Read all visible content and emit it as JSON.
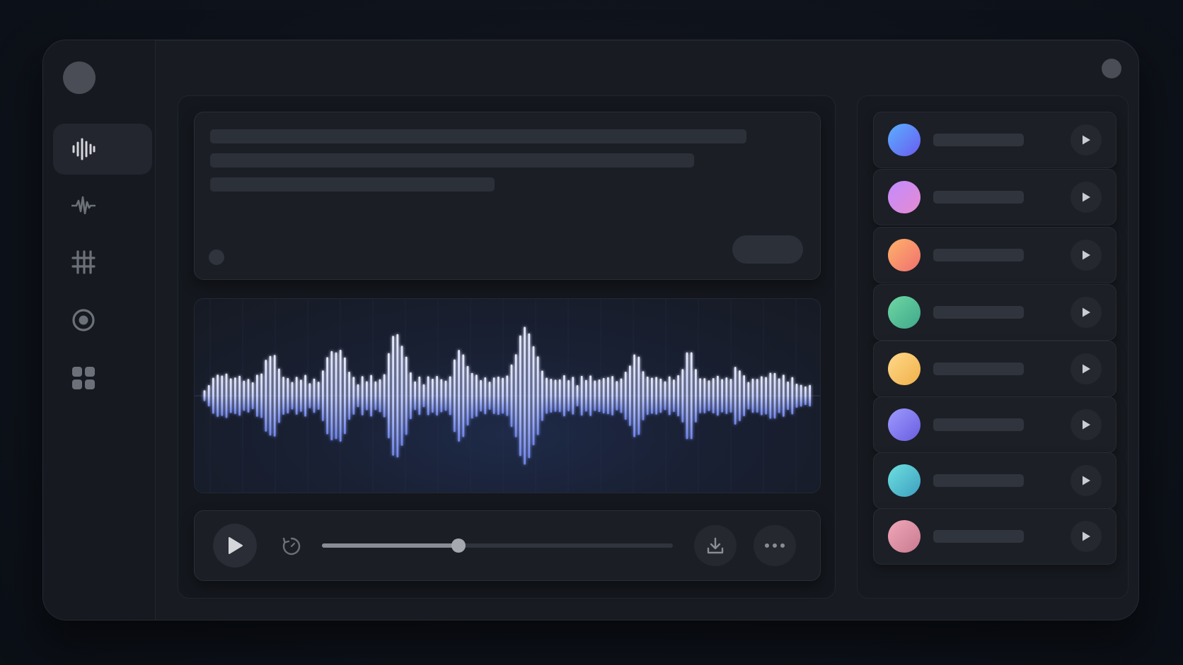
{
  "sidebar": {
    "icons": [
      "waveform-icon",
      "pulse-icon",
      "equalizer-icon",
      "record-icon",
      "grid-icon"
    ],
    "active_index": 0
  },
  "player": {
    "progress": 0.39
  },
  "voices": [
    {
      "gradient": [
        "#5ab0ff",
        "#6a5cf0"
      ]
    },
    {
      "gradient": [
        "#c38bff",
        "#e58bd0"
      ]
    },
    {
      "gradient": [
        "#ffb36b",
        "#f06f6f"
      ]
    },
    {
      "gradient": [
        "#6fd7a4",
        "#3fa88a"
      ]
    },
    {
      "gradient": [
        "#ffd98a",
        "#f0b04a"
      ]
    },
    {
      "gradient": [
        "#9d9bff",
        "#6a5de0"
      ]
    },
    {
      "gradient": [
        "#6ee0e0",
        "#3d9fc0"
      ]
    },
    {
      "gradient": [
        "#f0a8b8",
        "#c97a90"
      ]
    }
  ],
  "colors": {
    "accent_wave": "#7d8ef0",
    "background": "#0d1119",
    "panel": "#181b22"
  }
}
